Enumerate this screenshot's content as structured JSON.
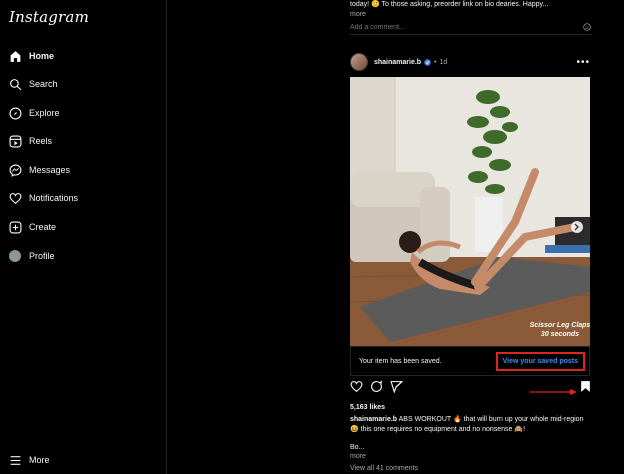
{
  "sidebar": {
    "logo": "Instagram",
    "items": [
      {
        "label": "Home"
      },
      {
        "label": "Search"
      },
      {
        "label": "Explore"
      },
      {
        "label": "Reels"
      },
      {
        "label": "Messages"
      },
      {
        "label": "Notifications"
      },
      {
        "label": "Create"
      },
      {
        "label": "Profile"
      }
    ],
    "more": "More"
  },
  "prev_post": {
    "caption": "today! 🙂 To those asking, preorder link on bio dearies. Happy...",
    "more": "more",
    "add_comment_placeholder": "Add a comment...",
    "emoji_icon": "smiley-icon"
  },
  "post": {
    "username": "shainamarie.b",
    "verified": true,
    "time": "1d",
    "media_overlay": {
      "line1": "Scissor Leg Claps",
      "line2": "30 seconds"
    },
    "saved_message": "Your item has been saved.",
    "saved_link": "View your saved posts",
    "likes": "5,163 likes",
    "caption_user": "shainamarie.b",
    "caption_text": "ABS WORKOUT 🔥 that will burn up your whole mid-region 😆 this one requires no equipment and no nonsense 🙈!",
    "caption_cont": "Bo...",
    "more": "more",
    "view_comments": "View all 41 comments"
  },
  "colors": {
    "accent_link": "#3d8ef0",
    "highlight": "#e0251f",
    "background": "#000000"
  }
}
